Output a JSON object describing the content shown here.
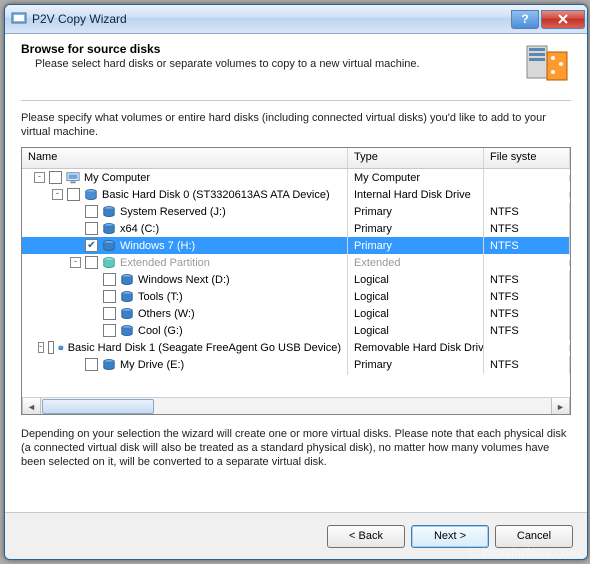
{
  "window_title": "P2V Copy Wizard",
  "header": {
    "title": "Browse for source disks",
    "subtitle": "Please select hard disks or separate volumes to copy to a new virtual machine."
  },
  "instruction": "Please specify what volumes or entire hard disks (including connected virtual disks) you'd like to add to your virtual machine.",
  "columns": {
    "name": "Name",
    "type": "Type",
    "fs": "File syste"
  },
  "tree": [
    {
      "indent": 0,
      "exp": "-",
      "cb": false,
      "icon": "computer",
      "label": "My Computer",
      "type": "My Computer",
      "fs": ""
    },
    {
      "indent": 1,
      "exp": "-",
      "cb": false,
      "icon": "disk",
      "label": "Basic Hard Disk 0 (ST3320613AS ATA Device)",
      "type": "Internal Hard Disk Drive",
      "fs": ""
    },
    {
      "indent": 2,
      "exp": "",
      "cb": false,
      "icon": "vol",
      "label": "System Reserved (J:)",
      "type": "Primary",
      "fs": "NTFS"
    },
    {
      "indent": 2,
      "exp": "",
      "cb": false,
      "icon": "vol",
      "label": "x64 (C:)",
      "type": "Primary",
      "fs": "NTFS"
    },
    {
      "indent": 2,
      "exp": "",
      "cb": true,
      "icon": "vol",
      "label": "Windows 7 (H:)",
      "type": "Primary",
      "fs": "NTFS",
      "selected": true
    },
    {
      "indent": 2,
      "exp": "-",
      "cb": false,
      "icon": "ext",
      "label": "Extended Partition",
      "type": "Extended",
      "fs": "",
      "disabled": true
    },
    {
      "indent": 3,
      "exp": "",
      "cb": false,
      "icon": "vol",
      "label": "Windows Next (D:)",
      "type": "Logical",
      "fs": "NTFS"
    },
    {
      "indent": 3,
      "exp": "",
      "cb": false,
      "icon": "vol",
      "label": "Tools (T:)",
      "type": "Logical",
      "fs": "NTFS"
    },
    {
      "indent": 3,
      "exp": "",
      "cb": false,
      "icon": "vol",
      "label": "Others (W:)",
      "type": "Logical",
      "fs": "NTFS"
    },
    {
      "indent": 3,
      "exp": "",
      "cb": false,
      "icon": "vol",
      "label": "Cool (G:)",
      "type": "Logical",
      "fs": "NTFS"
    },
    {
      "indent": 1,
      "exp": "-",
      "cb": false,
      "icon": "disk",
      "label": "Basic Hard Disk 1 (Seagate FreeAgent Go USB Device)",
      "type": "Removable Hard Disk Drive",
      "fs": ""
    },
    {
      "indent": 2,
      "exp": "",
      "cb": false,
      "icon": "vol",
      "label": "My Drive (E:)",
      "type": "Primary",
      "fs": "NTFS"
    }
  ],
  "footer_note": "Depending on your selection the wizard will create one or more virtual disks. Please note that each physical disk (a connected virtual disk will also be treated as a standard physical disk), no matter how many volumes have been selected on it, will be converted to a separate virtual disk.",
  "buttons": {
    "back": "< Back",
    "next": "Next >",
    "cancel": "Cancel"
  },
  "watermark": "© intowindows.com"
}
